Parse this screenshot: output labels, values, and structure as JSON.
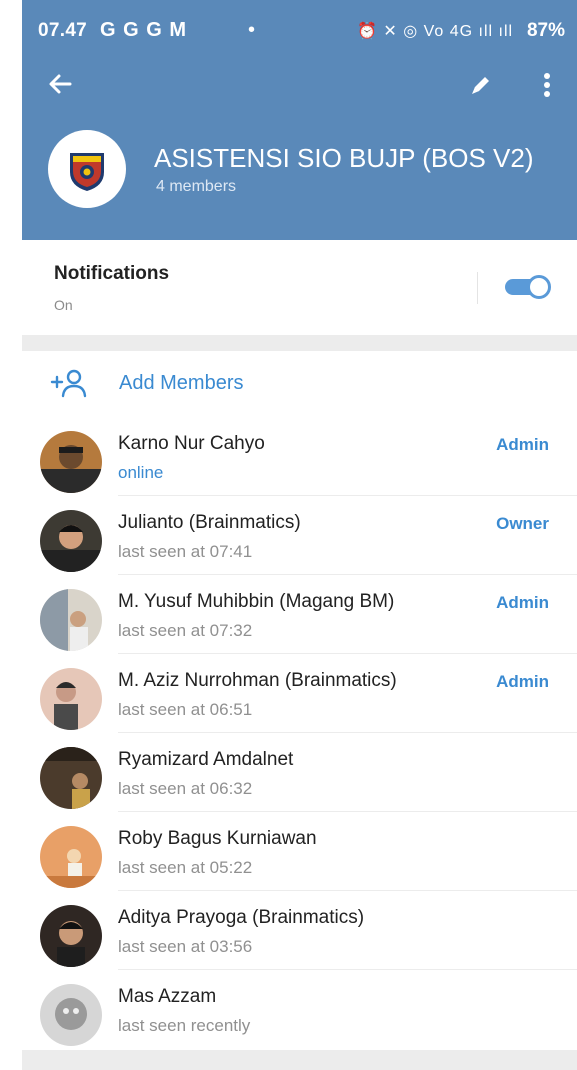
{
  "status_bar": {
    "time": "07.47",
    "left_icons": "G G G M",
    "dot": "•",
    "right_icons": "⏰ ✕ ◎ Vo 4G ıll ıll",
    "battery": "87%"
  },
  "header": {
    "back_icon": "arrow-left-icon",
    "edit_icon": "pencil-icon",
    "more_icon": "more-vertical-icon",
    "title": "ASISTENSI SIO BUJP (BOS V2)",
    "members_count": "4 members"
  },
  "notifications": {
    "label": "Notifications",
    "state": "On",
    "toggle_on": true
  },
  "add_members": {
    "label": "Add Members",
    "icon": "add-person-icon"
  },
  "members": [
    {
      "name": "Karno Nur Cahyo",
      "status": "online",
      "role": "Admin",
      "avatar_color": "#6b4a2e"
    },
    {
      "name": "Julianto (Brainmatics)",
      "status": "last seen at 07:41",
      "role": "Owner",
      "avatar_color": "#3c2f2a"
    },
    {
      "name": "M. Yusuf Muhibbin (Magang BM)",
      "status": "last seen at 07:32",
      "role": "Admin",
      "avatar_color": "#8d9aa6"
    },
    {
      "name": "M. Aziz Nurrohman (Brainmatics)",
      "status": "last seen at 06:51",
      "role": "Admin",
      "avatar_color": "#c79a86"
    },
    {
      "name": "Ryamizard Amdalnet",
      "status": "last seen at 06:32",
      "role": "",
      "avatar_color": "#4b3b2c"
    },
    {
      "name": "Roby Bagus Kurniawan",
      "status": "last seen at 05:22",
      "role": "",
      "avatar_color": "#d98a4f"
    },
    {
      "name": "Aditya Prayoga (Brainmatics)",
      "status": "last seen at 03:56",
      "role": "",
      "avatar_color": "#2f2723"
    },
    {
      "name": "Mas Azzam",
      "status": "last seen recently",
      "role": "",
      "avatar_color": "#b6b6b6"
    }
  ],
  "colors": {
    "header_bg": "#5a89b9",
    "accent": "#3a8ad1",
    "toggle": "#5a9ad8",
    "section_gap": "#ececec"
  }
}
